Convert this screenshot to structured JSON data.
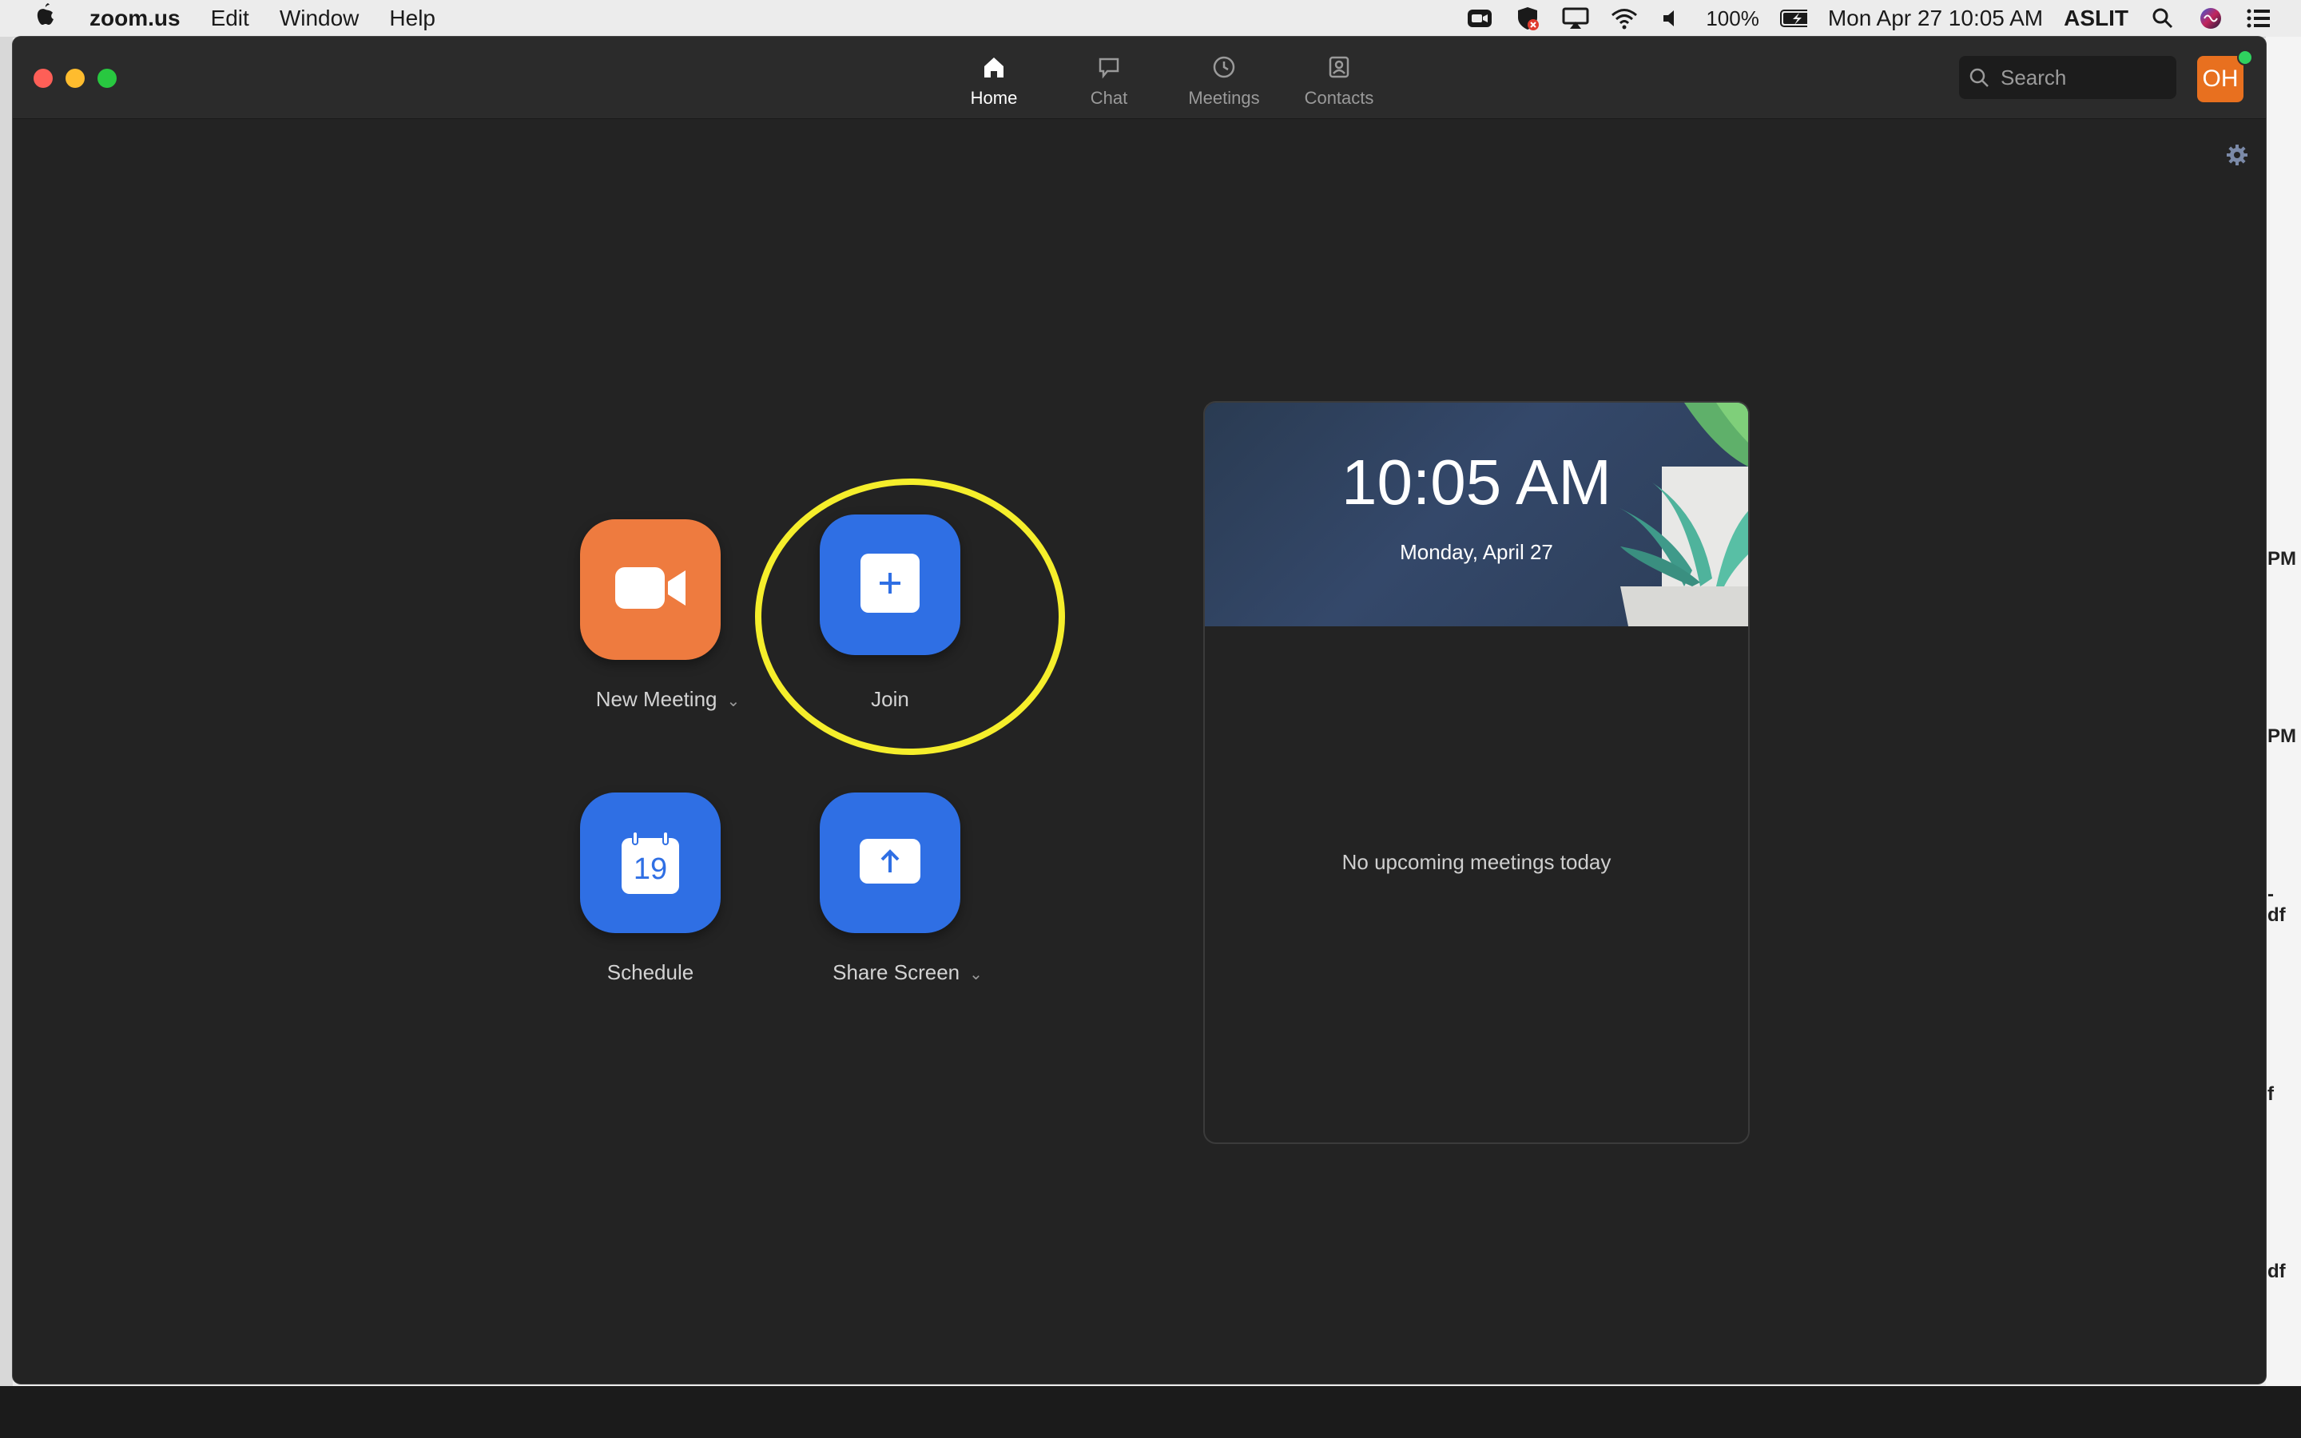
{
  "menubar": {
    "apple": "",
    "app_name": "zoom.us",
    "menus": [
      "Edit",
      "Window",
      "Help"
    ],
    "battery": "100%",
    "datetime": "Mon Apr 27  10:05 AM",
    "user": "ASLIT"
  },
  "tabs": [
    {
      "label": "Home",
      "icon": "home-icon",
      "active": true
    },
    {
      "label": "Chat",
      "icon": "chat-bubble-icon",
      "active": false
    },
    {
      "label": "Meetings",
      "icon": "clock-icon",
      "active": false
    },
    {
      "label": "Contacts",
      "icon": "contact-card-icon",
      "active": false
    }
  ],
  "search": {
    "placeholder": "Search"
  },
  "avatar": {
    "initials": "OH",
    "color": "#e8701f",
    "presence": "online"
  },
  "actions": {
    "new_meeting": {
      "label": "New Meeting",
      "color": "#ee7b3f",
      "icon": "video-camera-icon"
    },
    "join": {
      "label": "Join",
      "color": "#2f6fe4",
      "icon": "plus-icon",
      "highlighted": true
    },
    "schedule": {
      "label": "Schedule",
      "color": "#2f6fe4",
      "icon": "calendar-icon",
      "calendar_day": "19"
    },
    "share_screen": {
      "label": "Share Screen",
      "color": "#2f6fe4",
      "icon": "share-arrow-icon"
    }
  },
  "caret": "⌄",
  "calendar_panel": {
    "time": "10:05 AM",
    "date": "Monday, April 27",
    "empty_message": "No upcoming meetings today"
  },
  "colors": {
    "highlight": "#f5ee2b",
    "window_bg": "#232323"
  },
  "background_fragments": [
    "PM",
    "PM",
    "-",
    "df",
    "f",
    "df"
  ]
}
